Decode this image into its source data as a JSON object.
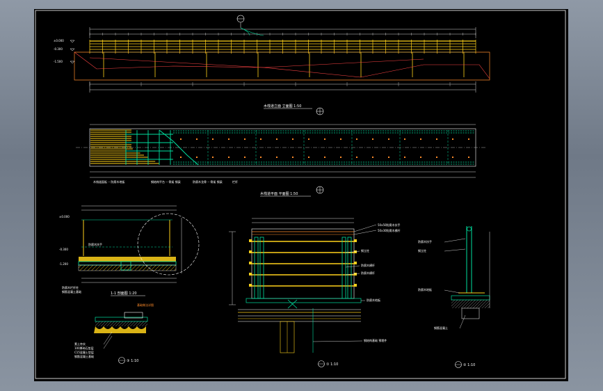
{
  "palette": {
    "outer_background": "#7b8593",
    "paper": "#000000",
    "border": "#ffffff",
    "dimension": "#d9d9d9",
    "rail": "#ffd21a",
    "structure": "#00e0a0",
    "section_line": "#ff8c2a",
    "centerline": "#ff4444",
    "label": "#ffffff",
    "hatch": "#ffd21a"
  },
  "icons": {
    "section_marker": "circle-with-crosshair",
    "north_marker": "circle-with-crosshair"
  },
  "views": {
    "elevation": {
      "title": "木栈道立面 立面图 1:50",
      "level_labels": [
        "±0.000",
        "-0.300",
        "-1.500"
      ]
    },
    "plan": {
      "title": "木栈道平面 平面图 1:50",
      "notes": [
        "木栈道面板 -- 防腐木地板",
        "钢结构平台 -- 骨架 钢梁",
        "防腐木龙骨 -- 骨架 钢梁",
        "栏杆"
      ]
    },
    "section_a": {
      "title": "1-1 剖面图 1:20",
      "level_labels": [
        "±0.000",
        "-0.300",
        "-1.200"
      ],
      "notes": [
        "防腐木扶手",
        "防腐木栏杆柱",
        "钢筋混凝土基础"
      ]
    },
    "railing_detail": {
      "title": "① 1:10",
      "notes": [
        "50x50防腐木扶手",
        "50x30防腐木横杆",
        "钢立柱",
        "防腐木横杆",
        "防腐木横杆",
        "防腐木地板",
        "钢结构基础 预埋件"
      ]
    },
    "post_detail": {
      "title": "② 1:10",
      "notes": [
        "防腐木扶手",
        "钢立柱",
        "防腐木地板",
        "钢筋混凝土"
      ]
    },
    "foundation_detail": {
      "title": "③ 1:10",
      "heading": "基础做法详图",
      "notes": [
        "素土夯实",
        "100厚碎石垫层",
        "C15混凝土垫层",
        "钢筋混凝土基础"
      ]
    }
  }
}
